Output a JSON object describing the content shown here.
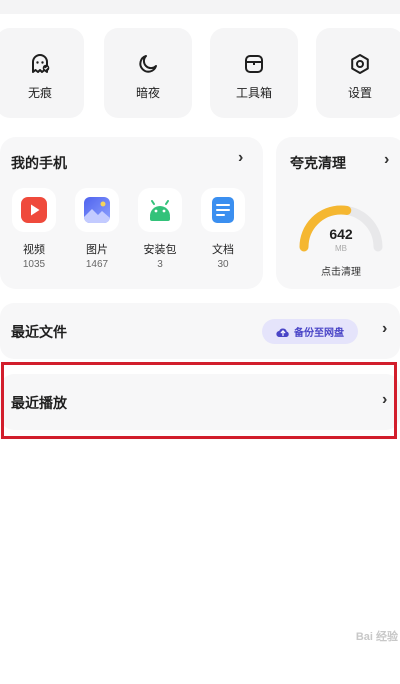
{
  "quick_tools": [
    {
      "label": "无痕",
      "icon": "ghost-icon"
    },
    {
      "label": "暗夜",
      "icon": "moon-icon"
    },
    {
      "label": "工具箱",
      "icon": "toolbox-icon"
    },
    {
      "label": "设置",
      "icon": "gear-icon"
    }
  ],
  "my_phone": {
    "title": "我的手机",
    "categories": [
      {
        "name": "视频",
        "count": "1035",
        "icon": "video-icon",
        "color": "#ef4a3c"
      },
      {
        "name": "图片",
        "count": "1467",
        "icon": "image-icon",
        "color": "#5b6df0"
      },
      {
        "name": "安装包",
        "count": "3",
        "icon": "android-icon",
        "color": "#33c27a"
      },
      {
        "name": "文档",
        "count": "30",
        "icon": "document-icon",
        "color": "#3b8ff0"
      }
    ]
  },
  "clean": {
    "title": "夸克清理",
    "size_value": "642",
    "size_unit": "MB",
    "action": "点击清理",
    "gauge_fill": 0.55,
    "gauge_color": "#f5b731"
  },
  "recent_files": {
    "title": "最近文件",
    "backup_label": "备份至网盘",
    "accent": "#4a45c7"
  },
  "recent_play": {
    "title": "最近播放"
  },
  "highlight_color": "#d21e2c",
  "watermark": "Bai 经验"
}
